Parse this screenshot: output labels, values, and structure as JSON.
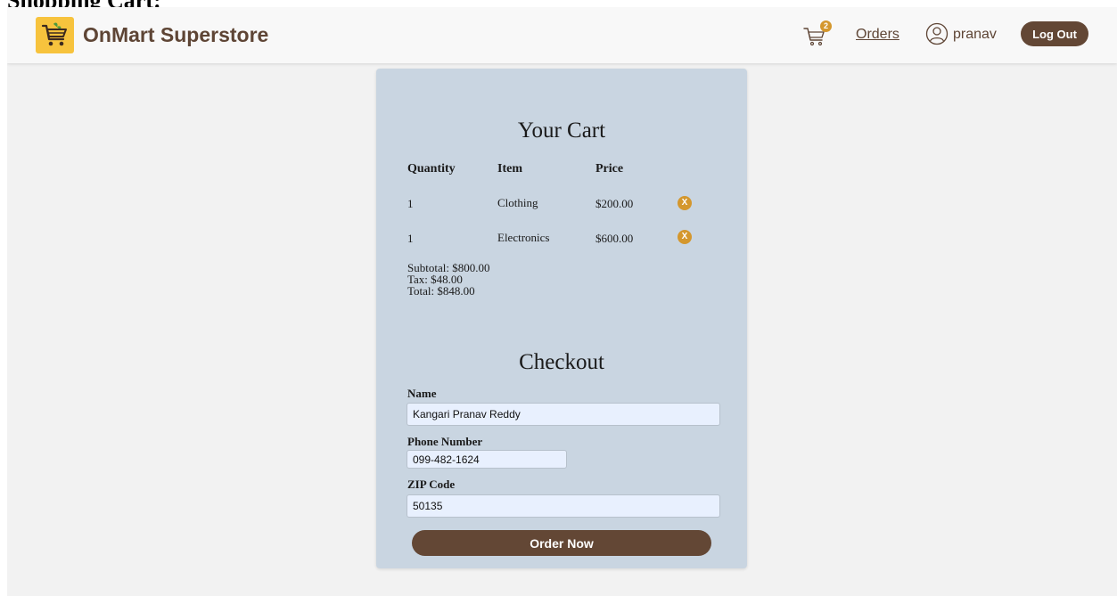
{
  "page": {
    "heading": "Shopping Cart:"
  },
  "navbar": {
    "brand": "OnMart Superstore",
    "cart_count": "2",
    "orders_label": "Orders",
    "username": "pranav",
    "logout_label": "Log Out"
  },
  "cart": {
    "title": "Your Cart",
    "headers": {
      "quantity": "Quantity",
      "item": "Item",
      "price": "Price"
    },
    "rows": [
      {
        "quantity": "1",
        "item": "Clothing",
        "price": "$200.00",
        "remove_label": "X"
      },
      {
        "quantity": "1",
        "item": "Electronics",
        "price": "$600.00",
        "remove_label": "X"
      }
    ],
    "subtotal": "Subtotal: $800.00",
    "tax": "Tax: $48.00",
    "total": "Total: $848.00"
  },
  "checkout": {
    "title": "Checkout",
    "name_label": "Name",
    "name_value": "Kangari Pranav Reddy",
    "phone_label": "Phone Number",
    "phone_value": "099-482-1624",
    "zip_label": "ZIP Code",
    "zip_value": "50135",
    "order_button": "Order Now"
  },
  "colors": {
    "brand_brown": "#634735",
    "accent_gold": "#d4972d",
    "logo_yellow": "#f7c33d",
    "card_background": "#c9d5e1",
    "input_background": "#e8f0fe"
  },
  "icons": {
    "logo": "shopping-cart-icon",
    "cart": "cart-icon",
    "user": "user-circle-icon",
    "remove": "close-icon"
  }
}
